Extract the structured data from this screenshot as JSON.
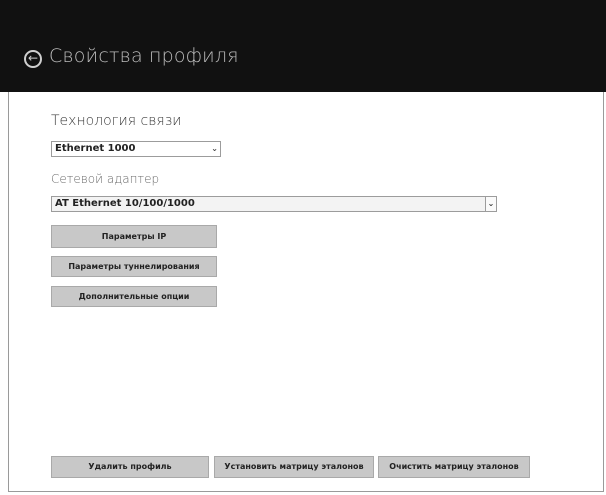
{
  "header": {
    "title": "Свойства профиля",
    "back_glyph": "←",
    "background": "#111111"
  },
  "form": {
    "tech_label": "Технология связи",
    "tech_value": "Ethernet 1000",
    "adapter_label": "Сетевой адаптер",
    "adapter_value": "AT Ethernet 10/100/1000"
  },
  "buttons": {
    "ip": "Параметры IP",
    "tunneling": "Параметры туннелирования",
    "extra": "Дополнительные опции",
    "delete_profile": "Удалить профиль",
    "set_matrix": "Установить матрицу эталонов",
    "clear_matrix": "Очистить матрицу эталонов"
  },
  "icons": {
    "back": "back-arrow-icon",
    "dropdown": "chevron-down-icon"
  }
}
